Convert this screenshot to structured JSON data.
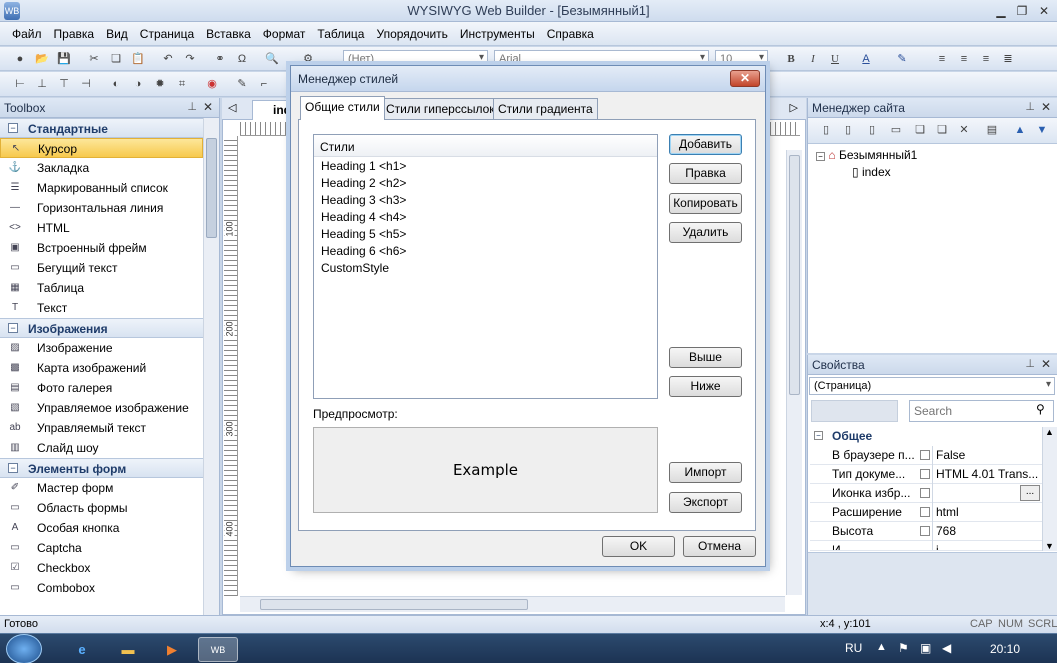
{
  "app": {
    "title": "WYSIWYG Web Builder - [Безымянный1]",
    "icon_label": "WB"
  },
  "menu": [
    "Файл",
    "Правка",
    "Вид",
    "Страница",
    "Вставка",
    "Формат",
    "Таблица",
    "Упорядочить",
    "Инструменты",
    "Справка"
  ],
  "toolbar": {
    "style_combo": "(Нет)",
    "font_combo": "Arial",
    "size_combo": "10"
  },
  "toolbox": {
    "title": "Toolbox",
    "groups": [
      {
        "name": "Стандартные",
        "items": [
          "Курсор",
          "Закладка",
          "Маркированный список",
          "Горизонтальная линия",
          "HTML",
          "Встроенный фрейм",
          "Бегущий текст",
          "Таблица",
          "Текст"
        ]
      },
      {
        "name": "Изображения",
        "items": [
          "Изображение",
          "Карта изображений",
          "Фото галерея",
          "Управляемое изображение",
          "Управляемый текст",
          "Слайд шоу"
        ]
      },
      {
        "name": "Элементы форм",
        "items": [
          "Мастер форм",
          "Область формы",
          "Особая кнопка",
          "Captcha",
          "Checkbox",
          "Combobox"
        ]
      }
    ],
    "selected": "Курсор"
  },
  "editor": {
    "tab": "index",
    "ruler_labels": [
      "100",
      "200",
      "300",
      "400"
    ]
  },
  "site_manager": {
    "title": "Менеджер сайта",
    "root": "Безымянный1",
    "page": "index"
  },
  "properties": {
    "title": "Свойства",
    "object": "(Страница)",
    "search_placeholder": "Search",
    "category": "Общее",
    "rows": [
      {
        "key": "В браузере п...",
        "value": "False"
      },
      {
        "key": "Тип докуме...",
        "value": "HTML 4.01 Trans..."
      },
      {
        "key": "Иконка избр...",
        "value": ""
      },
      {
        "key": "Расширение",
        "value": "html"
      },
      {
        "key": "Высота",
        "value": "768"
      },
      {
        "key": "И...",
        "value": "i..."
      }
    ],
    "ellipsis": "..."
  },
  "status": {
    "left": "Готово",
    "coords": "x:4 , y:101",
    "cap": "CAP",
    "num": "NUM",
    "scrl": "SCRL"
  },
  "taskbar": {
    "lang": "RU",
    "time": "20:10"
  },
  "dialog": {
    "title": "Менеджер стилей",
    "tabs": [
      "Общие стили",
      "Стили гиперссылок",
      "Стили градиента"
    ],
    "list_header": "Стили",
    "styles": [
      "Heading 1 <h1>",
      "Heading 2 <h2>",
      "Heading 3 <h3>",
      "Heading 4 <h4>",
      "Heading 5 <h5>",
      "Heading 6 <h6>",
      "CustomStyle"
    ],
    "buttons": {
      "add": "Добавить",
      "edit": "Правка",
      "copy": "Копировать",
      "delete": "Удалить",
      "up": "Выше",
      "down": "Ниже",
      "import": "Импорт",
      "export": "Экспорт",
      "ok": "OK",
      "cancel": "Отмена"
    },
    "preview_label": "Предпросмотр:",
    "preview_text": "Example"
  }
}
